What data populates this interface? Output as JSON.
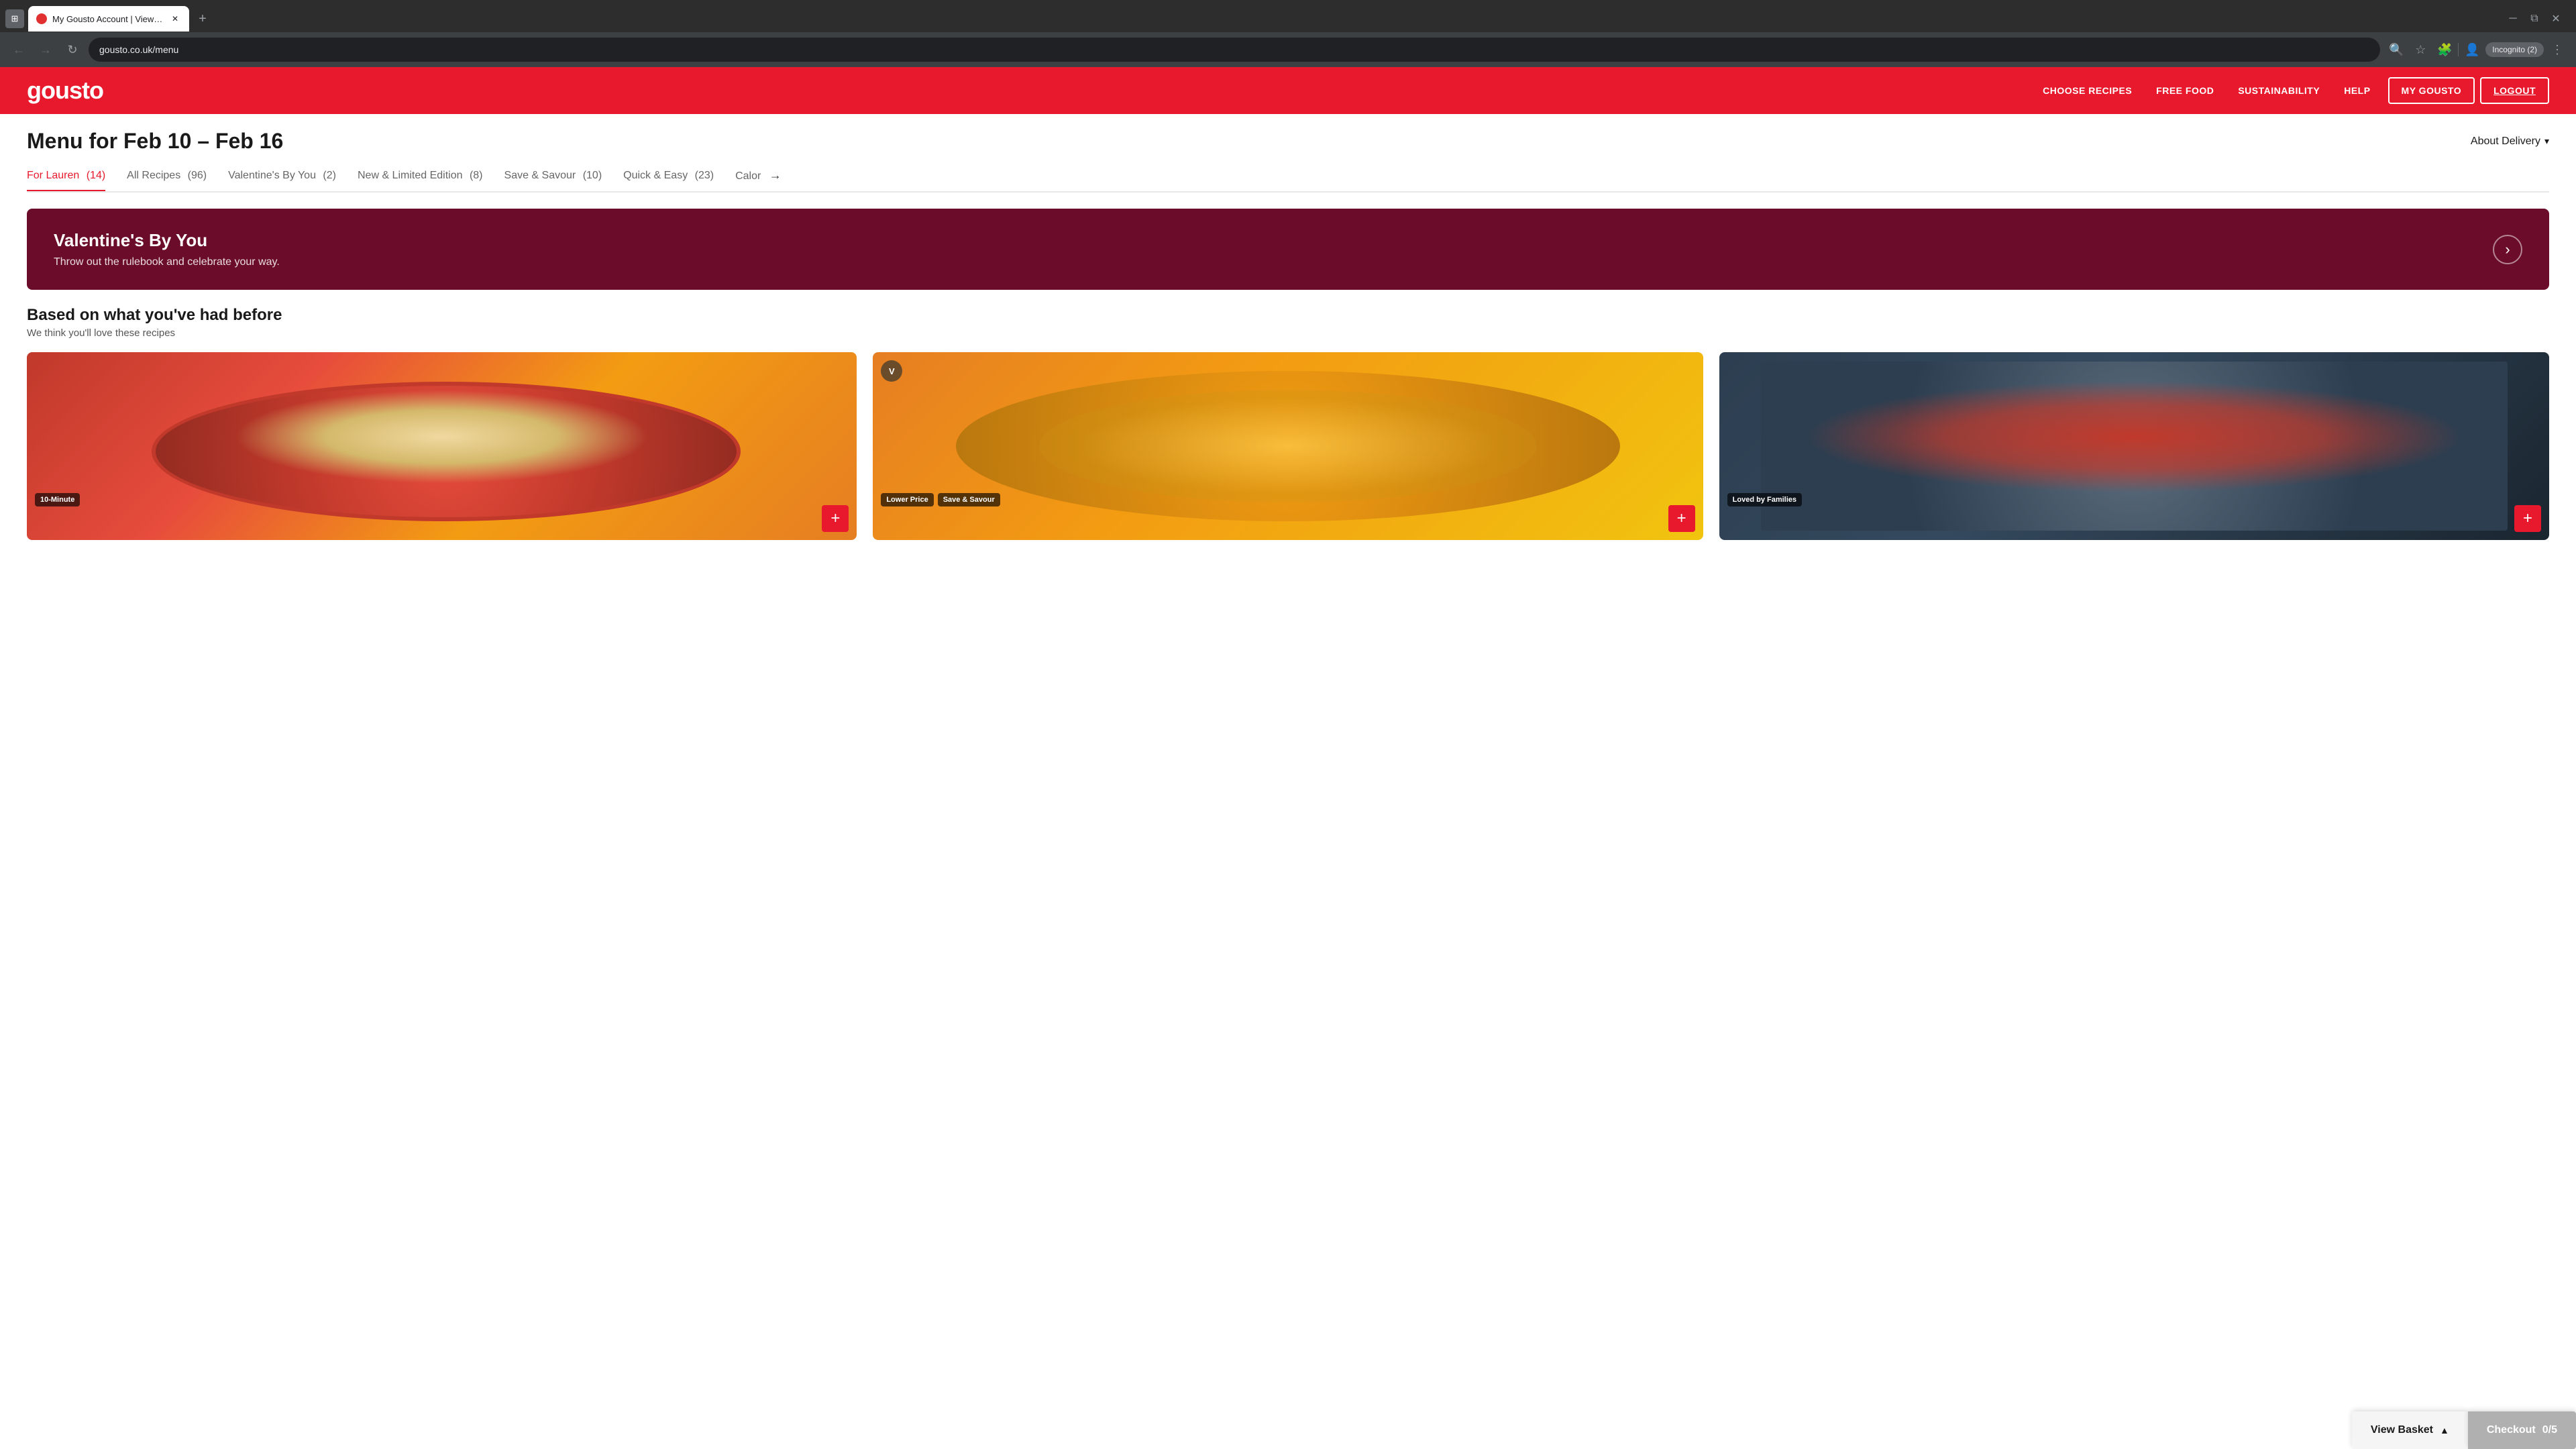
{
  "browser": {
    "tabs": [
      {
        "id": "tab1",
        "title": "My Gousto Account | View You...",
        "url": "gousto.co.uk/menu",
        "active": true,
        "favicon_color": "#e8192c"
      }
    ],
    "new_tab_label": "+",
    "address": "gousto.co.uk/menu",
    "incognito_label": "Incognito (2)",
    "nav": {
      "back_disabled": true,
      "forward_disabled": true
    }
  },
  "site": {
    "logo": "gousto",
    "nav_links": [
      {
        "id": "choose-recipes",
        "label": "CHOOSE RECIPES"
      },
      {
        "id": "free-food",
        "label": "FREE FOOD"
      },
      {
        "id": "sustainability",
        "label": "SUSTAINABILITY"
      },
      {
        "id": "help",
        "label": "HELP"
      }
    ],
    "nav_buttons": [
      {
        "id": "my-gousto",
        "label": "MY GOUSTO"
      },
      {
        "id": "logout",
        "label": "LOGOUT"
      }
    ]
  },
  "page": {
    "title": "Menu for Feb 10 – Feb 16",
    "about_delivery": {
      "label": "About Delivery",
      "chevron": "▾"
    }
  },
  "filters": {
    "items": [
      {
        "id": "for-lauren",
        "label": "For Lauren",
        "count": "14",
        "active": true
      },
      {
        "id": "all-recipes",
        "label": "All Recipes",
        "count": "96",
        "active": false
      },
      {
        "id": "valentines",
        "label": "Valentine's By You",
        "count": "2",
        "active": false
      },
      {
        "id": "new-limited",
        "label": "New & Limited Edition",
        "count": "8",
        "active": false
      },
      {
        "id": "save-savour",
        "label": "Save & Savour",
        "count": "10",
        "active": false
      },
      {
        "id": "quick-easy",
        "label": "Quick & Easy",
        "count": "23",
        "active": false
      },
      {
        "id": "calorie",
        "label": "Calor",
        "count": "",
        "active": false,
        "has_arrow": true
      }
    ]
  },
  "banner": {
    "title": "Valentine's By You",
    "subtitle": "Throw out the rulebook and celebrate your way.",
    "arrow": "›"
  },
  "section": {
    "title": "Based on what you've had before",
    "subtitle": "We think you'll love these recipes"
  },
  "recipes": [
    {
      "id": "recipe1",
      "badges": [
        "10-Minute"
      ],
      "has_v_badge": false,
      "add_label": "+"
    },
    {
      "id": "recipe2",
      "badges": [
        "Lower Price",
        "Save & Savour"
      ],
      "has_v_badge": true,
      "v_label": "V",
      "add_label": "+"
    },
    {
      "id": "recipe3",
      "badges": [
        "Loved by Families"
      ],
      "has_v_badge": false,
      "add_label": "+"
    }
  ],
  "bottom_bar": {
    "view_basket_label": "View Basket",
    "basket_chevron": "▲",
    "checkout_label": "Checkout",
    "checkout_count": "0/5"
  }
}
